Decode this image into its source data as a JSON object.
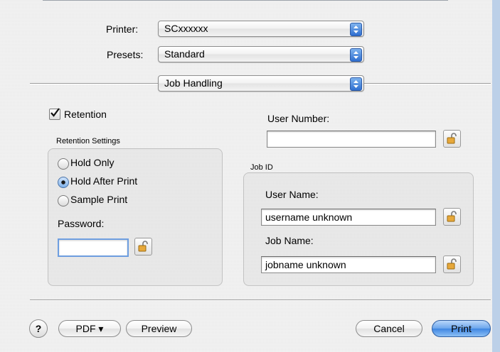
{
  "printer": {
    "label": "Printer:",
    "value": "SCxxxxxx"
  },
  "presets": {
    "label": "Presets:",
    "value": "Standard"
  },
  "panel": {
    "value": "Job Handling"
  },
  "retention": {
    "label": "Retention",
    "checked": true
  },
  "retention_settings": {
    "title": "Retention Settings",
    "options": [
      {
        "label": "Hold Only",
        "selected": false
      },
      {
        "label": "Hold After Print",
        "selected": true
      },
      {
        "label": "Sample Print",
        "selected": false
      }
    ],
    "password_label": "Password:",
    "password_value": ""
  },
  "user_number": {
    "label": "User Number:",
    "value": ""
  },
  "job_id": {
    "title": "Job ID",
    "user_name_label": "User Name:",
    "user_name_value": "username unknown",
    "job_name_label": "Job Name:",
    "job_name_value": "jobname unknown"
  },
  "footer": {
    "help": "?",
    "pdf": "PDF ▾",
    "preview": "Preview",
    "cancel": "Cancel",
    "print": "Print"
  },
  "colors": {
    "accent": "#3f86e2",
    "background": "#ececec"
  }
}
